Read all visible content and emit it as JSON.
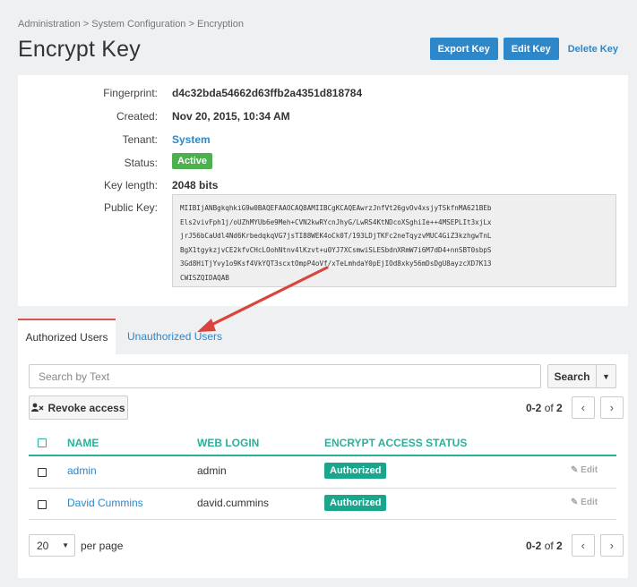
{
  "breadcrumb": [
    "Administration",
    "System Configuration",
    "Encryption"
  ],
  "breadcrumb_sep": ">",
  "page_title": "Encrypt Key",
  "actions": {
    "export": "Export Key",
    "edit": "Edit Key",
    "delete": "Delete Key"
  },
  "details": {
    "fingerprint_label": "Fingerprint:",
    "fingerprint": "d4c32bda54662d63ffb2a4351d818784",
    "created_label": "Created:",
    "created": "Nov 20, 2015, 10:34 AM",
    "tenant_label": "Tenant:",
    "tenant": "System",
    "status_label": "Status:",
    "status": "Active",
    "keylength_label": "Key length:",
    "keylength": "2048 bits",
    "pubkey_label": "Public Key:",
    "pubkey": "MIIBIjANBgkqhkiG9w0BAQEFAAOCAQ8AMIIBCgKCAQEAwrzJnfVt26gvOv4xsjyTSkfnMA621BEb\nEls2vivFph1j/oUZhMYUb6e9Meh+CVN2kwRYcnJhyG/LwRS4KtNDcoXSghiIe++4MSEPLIt3xjLx\njrJ56bCaUdl4Nd6KrbedqkqVG7jsTI88WEK4oCk0T/193LDjTKFc2neTqyzvMUC4GiZ3kzhgwTnL\nBgX1tgykzjvCE2kfvCHcLOohNtnv4lKzvt+u0YJ7XCsmwiSLESbdnXRmW7i6M7dD4+nnSBT0sbpS\n3Gd8HiTjYvy1o9Ksf4VkYQT3scxtOmpP4oVf/xTeLmhdaY0pEjIOd8xky56mDsDgU8ayzcXD7K13\nCWISZQIDAQAB"
  },
  "tabs": {
    "authorized": "Authorized Users",
    "unauthorized": "Unauthorized Users"
  },
  "search": {
    "placeholder": "Search by Text",
    "button": "Search",
    "dropdown_icon": "caret-down-icon"
  },
  "revoke": {
    "label": "Revoke access",
    "icon": "user-remove-icon"
  },
  "pager": {
    "range": "0-2",
    "of": "of",
    "total": "2"
  },
  "table": {
    "headers": [
      "NAME",
      "WEB LOGIN",
      "ENCRYPT ACCESS STATUS"
    ],
    "rows": [
      {
        "name": "admin",
        "login": "admin",
        "status": "Authorized",
        "edit": "Edit"
      },
      {
        "name": "David Cummins",
        "login": "david.cummins",
        "status": "Authorized",
        "edit": "Edit"
      }
    ]
  },
  "per_page": {
    "value": "20",
    "label": "per page"
  },
  "colors": {
    "primary": "#2e87c8",
    "active_tab": "#d9534f",
    "teal": "#2ab19b",
    "status_active": "#4cb04f",
    "authorized_badge": "#1aa68c",
    "annotation_arrow": "#d9453d"
  }
}
